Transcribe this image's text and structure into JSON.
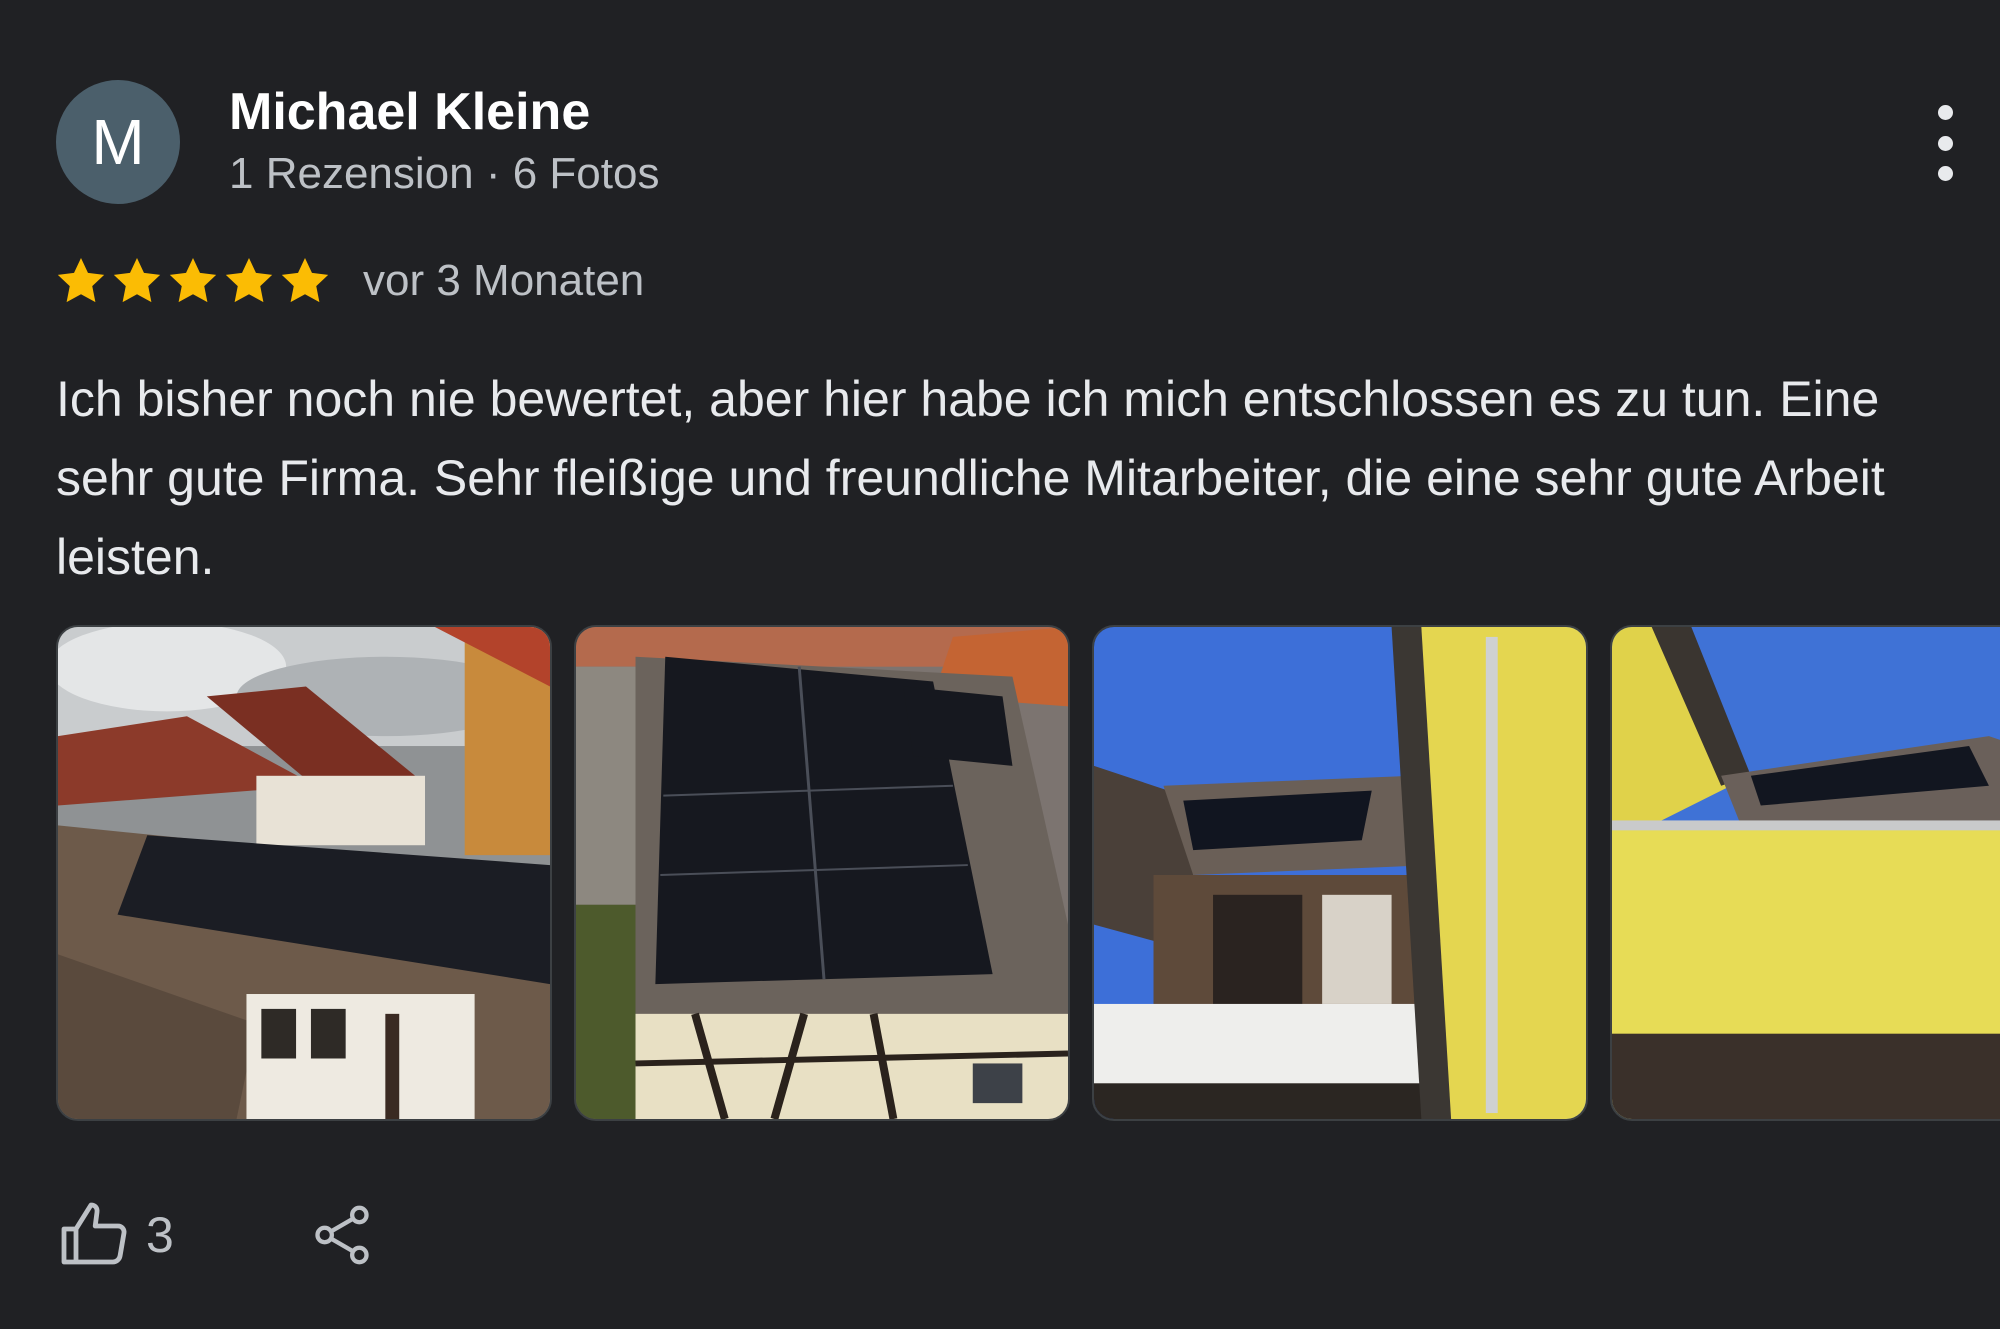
{
  "review": {
    "avatar_letter": "M",
    "author_name": "Michael Kleine",
    "author_meta": "1 Rezension · 6 Fotos",
    "rating": 5,
    "rating_max": 5,
    "date": "vor 3 Monaten",
    "text": "Ich bisher noch nie bewertet, aber hier habe ich mich entschlossen es zu tun. Eine sehr gute Firma. Sehr fleißige und freundliche Mitarbeiter, die eine sehr gute Arbeit leisten.",
    "like_count": "3"
  },
  "colors": {
    "background": "#202124",
    "avatar": "#4b5f6b",
    "star": "#fbbc04",
    "primary_text": "#e8eaed",
    "secondary_text": "#bdc1c6"
  },
  "icons": {
    "more": "more-vert-icon",
    "star": "star-icon",
    "like": "thumb-up-icon",
    "share": "share-icon"
  }
}
